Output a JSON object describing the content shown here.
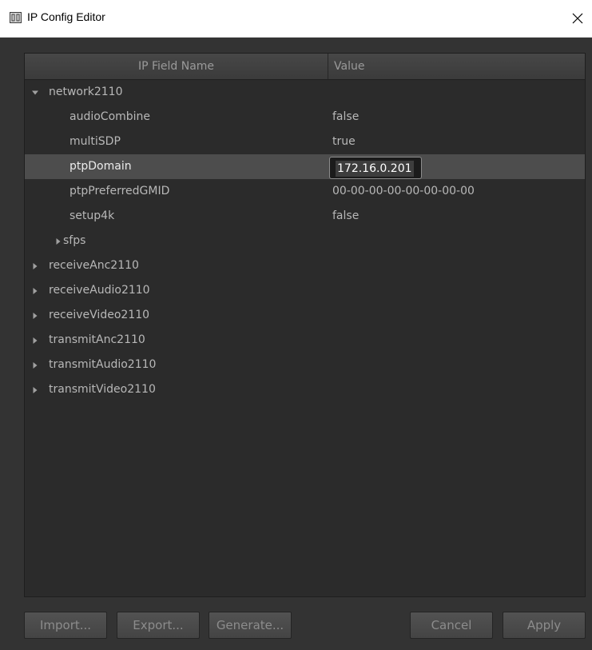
{
  "window": {
    "title": "IP Config Editor",
    "icon": "app-icon",
    "close_icon": "close-icon"
  },
  "table": {
    "columns": [
      "IP Field Name",
      "Value"
    ],
    "rows": [
      {
        "name": "network2110",
        "value": "",
        "expander": "expanded"
      },
      {
        "name": "audioCombine",
        "value": "false",
        "expander": "none"
      },
      {
        "name": "multiSDP",
        "value": "true",
        "expander": "none"
      },
      {
        "name": "ptpDomain",
        "value": "",
        "expander": "none",
        "selected": true,
        "editing_value": "172.16.0.201"
      },
      {
        "name": "ptpPreferredGMID",
        "value": "00-00-00-00-00-00-00-00",
        "expander": "none"
      },
      {
        "name": "setup4k",
        "value": "false",
        "expander": "none"
      },
      {
        "name": "sfps",
        "value": "",
        "expander": "collapsed"
      },
      {
        "name": "receiveAnc2110",
        "value": "",
        "expander": "collapsed"
      },
      {
        "name": "receiveAudio2110",
        "value": "",
        "expander": "collapsed"
      },
      {
        "name": "receiveVideo2110",
        "value": "",
        "expander": "collapsed"
      },
      {
        "name": "transmitAnc2110",
        "value": "",
        "expander": "collapsed"
      },
      {
        "name": "transmitAudio2110",
        "value": "",
        "expander": "collapsed"
      },
      {
        "name": "transmitVideo2110",
        "value": "",
        "expander": "collapsed"
      }
    ]
  },
  "buttons": {
    "import": "Import...",
    "export": "Export...",
    "generate": "Generate...",
    "cancel": "Cancel",
    "apply": "Apply"
  },
  "colors": {
    "background": "#333333",
    "panel": "#2b2b2b",
    "selected_row": "#4d4d4d",
    "text": "#b8b8b8"
  }
}
